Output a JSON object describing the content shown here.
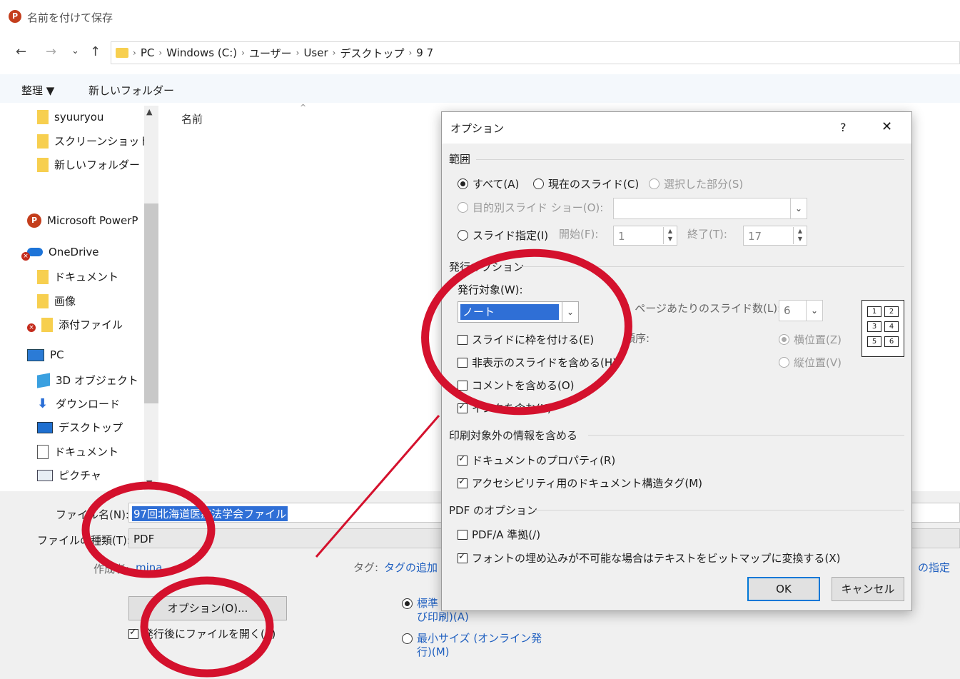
{
  "window": {
    "title": "名前を付けて保存",
    "app_icon": "P"
  },
  "nav": {
    "back": "←",
    "forward": "→",
    "recent": "⌄",
    "up": "↑",
    "breadcrumb": [
      "PC",
      "Windows (C:)",
      "ユーザー",
      "User",
      "デスクトップ",
      "9 7"
    ]
  },
  "toolbar": {
    "organize": "整理 ▼",
    "new_folder": "新しいフォルダー"
  },
  "sidebar": {
    "items": [
      {
        "label": "syuuryou",
        "icon": "folder-icon"
      },
      {
        "label": "スクリーンショット",
        "icon": "folder-icon"
      },
      {
        "label": "新しいフォルダー",
        "icon": "folder-icon"
      },
      {
        "label": "Microsoft PowerP",
        "icon": "powerpoint-icon"
      },
      {
        "label": "OneDrive",
        "icon": "onedrive-icon"
      },
      {
        "label": "ドキュメント",
        "icon": "folder-icon"
      },
      {
        "label": "画像",
        "icon": "folder-icon"
      },
      {
        "label": "添付ファイル",
        "icon": "folder-icon"
      },
      {
        "label": "PC",
        "icon": "pc-icon"
      },
      {
        "label": "3D オブジェクト",
        "icon": "3d-objects-icon"
      },
      {
        "label": "ダウンロード",
        "icon": "download-icon"
      },
      {
        "label": "デスクトップ",
        "icon": "desktop-icon"
      },
      {
        "label": "ドキュメント",
        "icon": "documents-icon"
      },
      {
        "label": "ピクチャ",
        "icon": "pictures-icon"
      }
    ]
  },
  "file_list": {
    "column_name": "名前"
  },
  "save_form": {
    "filename_label": "ファイル名(N):",
    "filename_value": "97回北海道医療法学会ファイル",
    "filetype_label": "ファイルの種類(T):",
    "filetype_value": "PDF",
    "author_label": "作成者:",
    "author_value": "mina",
    "tags_label": "タグ:",
    "tags_value": "タグの追加",
    "right_link": "の指定",
    "options_button": "オプション(O)...",
    "open_after_label": "発行後にファイルを開く(E)",
    "optimize_standard": "標準 (オンライン発行および印刷)(A)",
    "optimize_standard_line1": "標準",
    "optimize_standard_line2": "び印刷)(A)",
    "optimize_min_line1": "最小サイズ (オンライン発",
    "optimize_min_line2": "行)(M)"
  },
  "dialog": {
    "title": "オプション",
    "help": "?",
    "close": "✕",
    "range_section": "範囲",
    "range_all": "すべて(A)",
    "range_current": "現在のスライド(C)",
    "range_selection": "選択した部分(S)",
    "custom_show": "目的別スライド ショー(O):",
    "slides": "スライド指定(I)",
    "from_label": "開始(F):",
    "from_value": "1",
    "to_label": "終了(T):",
    "to_value": "17",
    "publish_section": "発行オプション",
    "publish_what_label": "発行対象(W):",
    "publish_what_value": "ノート",
    "slides_per_page_label": "1 ページあたりのスライド数(L):",
    "slides_per_page_value": "6",
    "order_label": "順序:",
    "horizontal": "横位置(Z)",
    "vertical": "縦位置(V)",
    "frame_slides": "スライドに枠を付ける(E)",
    "include_hidden": "非表示のスライドを含める(H)",
    "include_comments": "コメントを含める(O)",
    "include_ink": "インクを含む(K)",
    "nonprint_section": "印刷対象外の情報を含める",
    "doc_properties": "ドキュメントのプロパティ(R)",
    "struct_tags": "アクセシビリティ用のドキュメント構造タグ(M)",
    "pdf_section": "PDF のオプション",
    "pdfa": "PDF/A 準拠(/)",
    "bitmap_text": "フォントの埋め込みが不可能な場合はテキストをビットマップに変換する(X)",
    "ok": "OK",
    "cancel": "キャンセル",
    "grid_numbers": [
      "1",
      "2",
      "3",
      "4",
      "5",
      "6"
    ]
  },
  "colors": {
    "annotation": "#d4112d",
    "selection": "#2f6fd6",
    "accent": "#0078d7"
  }
}
